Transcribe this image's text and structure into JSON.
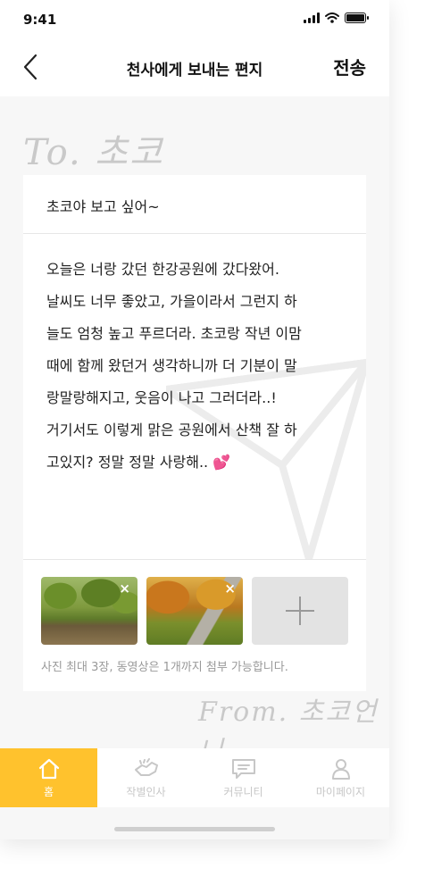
{
  "status_bar": {
    "time": "9:41"
  },
  "nav": {
    "back_icon": "chevron-left-icon",
    "title": "천사에게 보내는 편지",
    "send_label": "전송"
  },
  "letter": {
    "to_handwriting": "To. 초코",
    "subject": "초코야 보고 싶어~",
    "body": "오늘은 너랑 갔던 한강공원에 갔다왔어.\n날씨도 너무 좋았고, 가을이라서 그런지 하\n늘도 엄청 높고 푸르더라. 초코랑 작년 이맘\n때에 함께 왔던거 생각하니까 더 기분이 말\n랑말랑해지고, 웃음이 나고 그러더라..!\n거기서도 이렇게 맑은 공원에서 산책 잘 하\n고있지? 정말 정말 사랑해.. 💕",
    "from_handwriting": "From. 초코언니"
  },
  "attachments": {
    "photos": [
      {
        "name": "park-photo",
        "remove_label": "×"
      },
      {
        "name": "autumn-path-photo",
        "remove_label": "×"
      }
    ],
    "add_icon": "plus-icon",
    "notice": "사진 최대 3장, 동영상은 1개까지 첨부 가능합니다."
  },
  "tab_bar": {
    "items": [
      {
        "label": "홈",
        "icon": "home-icon",
        "active": true
      },
      {
        "label": "작별인사",
        "icon": "hands-icon",
        "active": false
      },
      {
        "label": "커뮤니티",
        "icon": "chat-bubble-icon",
        "active": false
      },
      {
        "label": "마이페이지",
        "icon": "person-icon",
        "active": false
      }
    ]
  },
  "colors": {
    "accent": "#FFC22D",
    "background": "#F7F7F7",
    "inactive_tab": "#C7C7C7"
  }
}
